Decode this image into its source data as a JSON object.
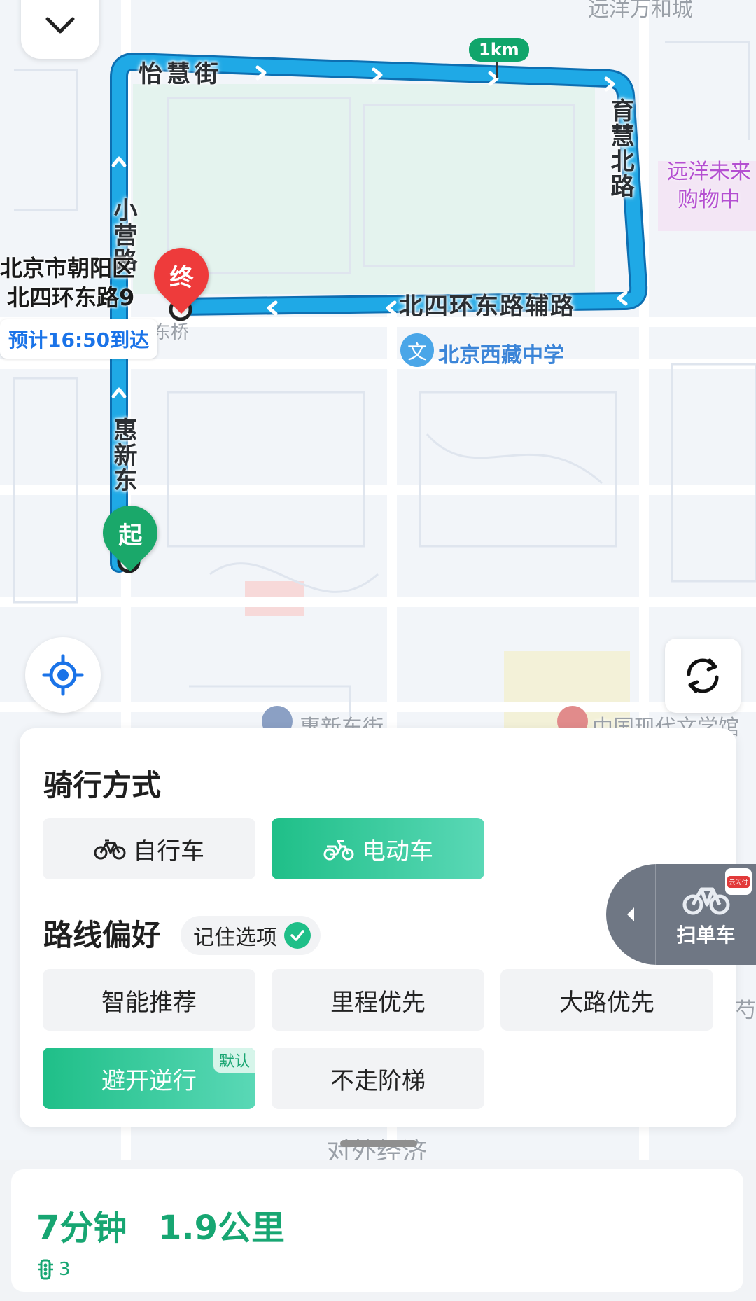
{
  "map": {
    "streets": {
      "top": "怡慧街",
      "right": "育慧北路",
      "bottom": "北四环东路辅路",
      "left_upper": "小营路",
      "left_lower": "惠新东"
    },
    "pois": {
      "school": "北京西藏中学",
      "mall": "远洋未来购物中",
      "top_faded": "远洋万和城",
      "lower_street": "惠新东街",
      "lower_right": "中国现代文学馆",
      "bottom_faded": "对外经济",
      "bridge_fragment": "东桥",
      "edge_fragment": "芍"
    },
    "scale": "1km",
    "destination_marker": "终",
    "start_marker": "起",
    "destination_address_line1": "北京市朝阳区",
    "destination_address_line2": "北四环东路9",
    "eta_text": "预计16:50到达",
    "route_color": "#1fa9e6"
  },
  "panel": {
    "ride_mode_title": "骑行方式",
    "modes": [
      {
        "label": "自行车",
        "icon": "bicycle-icon",
        "active": false
      },
      {
        "label": "电动车",
        "icon": "scooter-icon",
        "active": true
      }
    ],
    "preference_title": "路线偏好",
    "remember_label": "记住选项",
    "preferences": [
      {
        "label": "智能推荐",
        "active": false
      },
      {
        "label": "里程优先",
        "active": false
      },
      {
        "label": "大路优先",
        "active": false
      },
      {
        "label": "避开逆行",
        "active": true,
        "tag": "默认"
      },
      {
        "label": "不走阶梯",
        "active": false
      }
    ],
    "accent": "#1fbf88"
  },
  "scan_bike": {
    "label": "扫单车",
    "badge": "云闪付"
  },
  "summary": {
    "time": "7分钟",
    "distance": "1.9公里",
    "traffic_lights": "3"
  }
}
